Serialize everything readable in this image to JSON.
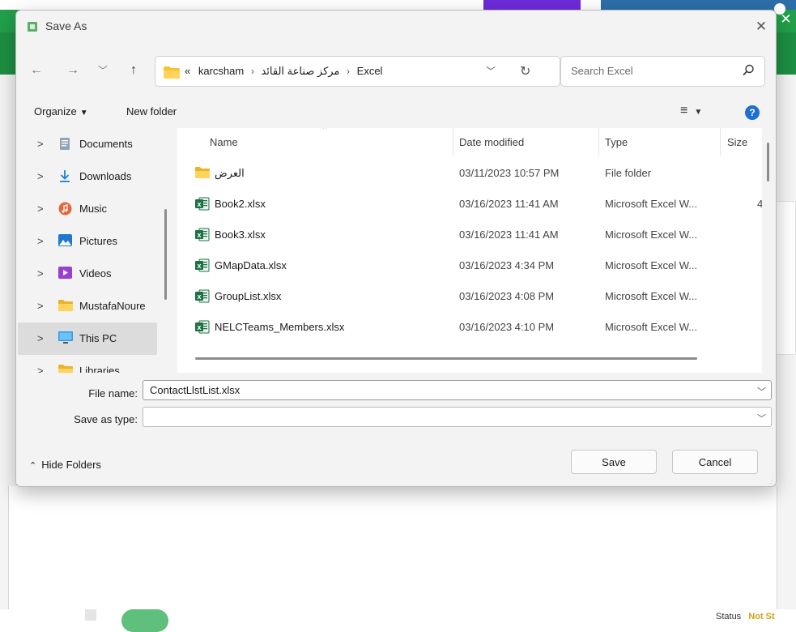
{
  "dialog": {
    "title": "Save As",
    "close_glyph": "✕"
  },
  "navigation": {
    "back_glyph": "←",
    "forward_glyph": "→",
    "recent_glyph": "﹀",
    "up_glyph": "↑"
  },
  "address": {
    "overflow": "«",
    "crumbs": [
      "karcsham",
      "مركز صناعة القائد",
      "Excel"
    ],
    "separator": "›",
    "dropdown_glyph": "﹀",
    "refresh_glyph": "↻"
  },
  "search": {
    "placeholder": "Search Excel",
    "icon": "search-icon"
  },
  "toolbar": {
    "organize_label": "Organize",
    "new_folder_label": "New folder",
    "view_glyph": "≡",
    "help_glyph": "?"
  },
  "sidebar": {
    "items": [
      {
        "label": "Documents",
        "icon": "documents-icon",
        "chevron": ">"
      },
      {
        "label": "Downloads",
        "icon": "downloads-icon",
        "chevron": ">"
      },
      {
        "label": "Music",
        "icon": "music-icon",
        "chevron": ">"
      },
      {
        "label": "Pictures",
        "icon": "pictures-icon",
        "chevron": ">"
      },
      {
        "label": "Videos",
        "icon": "videos-icon",
        "chevron": ">"
      },
      {
        "label": "MustafaNoure",
        "icon": "folder-icon",
        "chevron": ">"
      },
      {
        "label": "This PC",
        "icon": "computer-icon",
        "chevron": ">",
        "selected": true
      },
      {
        "label": "Libraries",
        "icon": "folder-icon",
        "chevron": ">"
      }
    ]
  },
  "files": {
    "columns": [
      "Name",
      "Date modified",
      "Type",
      "Size"
    ],
    "rows": [
      {
        "name": "العرض",
        "date": "03/11/2023 10:57 PM",
        "type": "File folder",
        "size": "",
        "icon": "folder-icon"
      },
      {
        "name": "Book2.xlsx",
        "date": "03/16/2023 11:41 AM",
        "type": "Microsoft Excel W...",
        "size": "4",
        "icon": "excel-file-icon"
      },
      {
        "name": "Book3.xlsx",
        "date": "03/16/2023 11:41 AM",
        "type": "Microsoft Excel W...",
        "size": "",
        "icon": "excel-file-icon"
      },
      {
        "name": "GMapData.xlsx",
        "date": "03/16/2023 4:34 PM",
        "type": "Microsoft Excel W...",
        "size": "",
        "icon": "excel-file-icon"
      },
      {
        "name": "GroupList.xlsx",
        "date": "03/16/2023 4:08 PM",
        "type": "Microsoft Excel W...",
        "size": "",
        "icon": "excel-file-icon"
      },
      {
        "name": "NELCTeams_Members.xlsx",
        "date": "03/16/2023 4:10 PM",
        "type": "Microsoft Excel W...",
        "size": "",
        "icon": "excel-file-icon"
      }
    ]
  },
  "form": {
    "file_name_label": "File name:",
    "file_name_value": "ContactLlstList.xlsx",
    "save_type_label": "Save as type:",
    "save_type_value": "",
    "hide_folders_label": "Hide Folders",
    "save_label": "Save",
    "cancel_label": "Cancel"
  },
  "background": {
    "status_label": "Status",
    "status_value": "Not St",
    "close_glyph": "✕"
  },
  "colors": {
    "accent_green": "#1d8f43",
    "help_blue": "#1f6ed4",
    "excel_green": "#1e7145",
    "folder_yellow": "#f4c430"
  }
}
